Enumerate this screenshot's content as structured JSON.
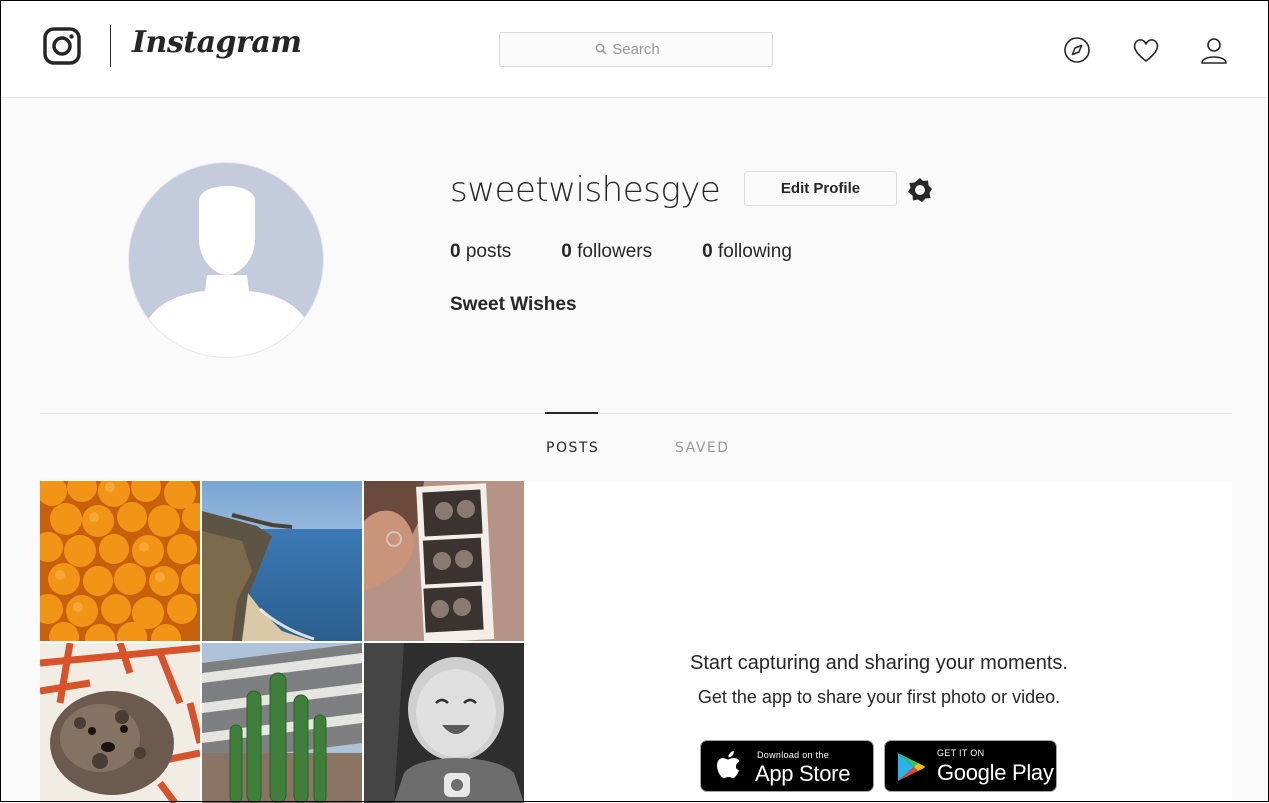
{
  "header": {
    "brand": "Instagram",
    "search_placeholder": "Search",
    "icons": [
      "instagram-glyph-icon",
      "compass-icon",
      "heart-icon",
      "person-icon"
    ]
  },
  "profile": {
    "username": "sweetwishesgye",
    "edit_button": "Edit Profile",
    "stats": {
      "posts_count": "0",
      "posts_label": "posts",
      "followers_count": "0",
      "followers_label": "followers",
      "following_count": "0",
      "following_label": "following"
    },
    "full_name": "Sweet Wishes"
  },
  "tabs": [
    {
      "label": "POSTS",
      "active": true
    },
    {
      "label": "SAVED",
      "active": false
    }
  ],
  "promo": {
    "title": "Start capturing and sharing your moments.",
    "subtitle": "Get the app to share your first photo or video.",
    "app_store": {
      "small": "Download on the",
      "big": "App Store"
    },
    "google_play": {
      "small": "GET IT ON",
      "big": "Google Play"
    }
  },
  "colors": {
    "border": "#dbdbdb",
    "text": "#262626",
    "muted": "#999999",
    "avatar_bg": "#c3cbdc"
  }
}
